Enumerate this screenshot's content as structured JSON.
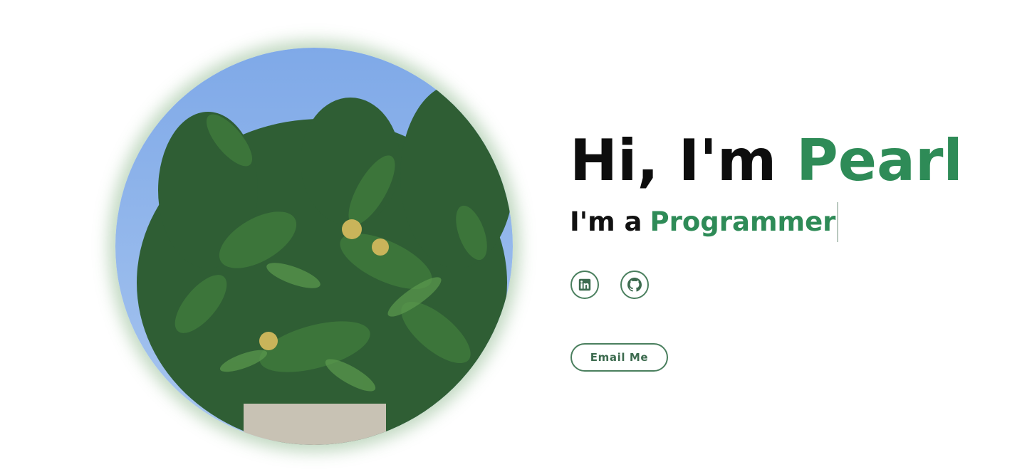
{
  "hero": {
    "greeting": "Hi, I'm ",
    "name": "Pearl",
    "role_prefix": "I'm a",
    "role": "Programmer"
  },
  "socials": [
    {
      "icon": "linkedin-icon"
    },
    {
      "icon": "github-icon"
    }
  ],
  "cta": {
    "email_label": "Email Me"
  },
  "colors": {
    "accent": "#2e8b57",
    "outline": "#4a7f5e",
    "text": "#0d0d0d"
  }
}
